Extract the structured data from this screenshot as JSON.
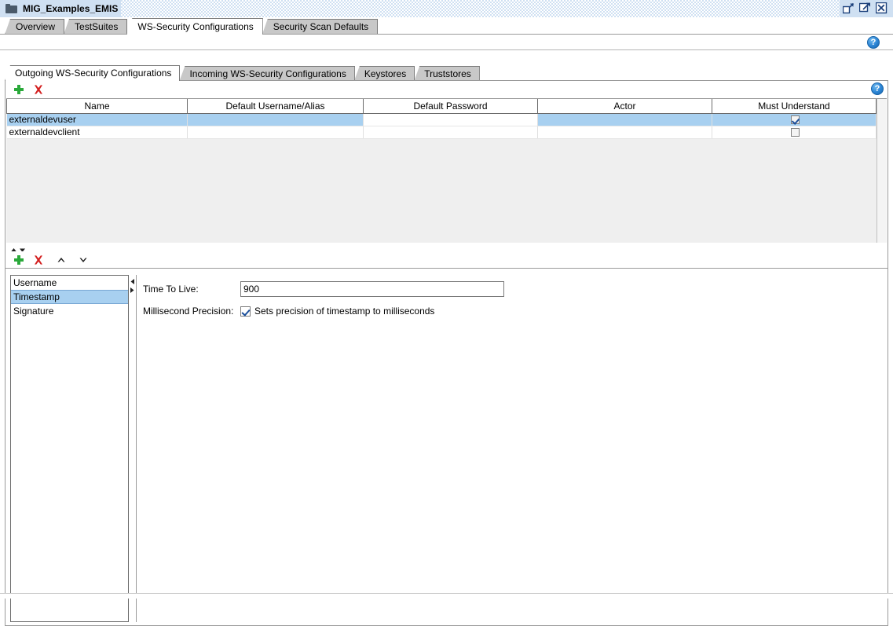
{
  "window": {
    "title": "MIG_Examples_EMIS",
    "folder_icon": "folder-icon",
    "buttons": [
      {
        "name": "restore-down-button",
        "icon": "restore-down-icon",
        "label": "Restore Down"
      },
      {
        "name": "maximize-button",
        "icon": "maximize-icon",
        "label": "Maximize"
      },
      {
        "name": "close-button",
        "icon": "close-icon",
        "label": "Close"
      }
    ]
  },
  "outer_tabs": [
    {
      "label": "Overview",
      "selected": false
    },
    {
      "label": "TestSuites",
      "selected": false
    },
    {
      "label": "WS-Security Configurations",
      "selected": true
    },
    {
      "label": "Security Scan Defaults",
      "selected": false
    }
  ],
  "inner_tabs": [
    {
      "label": "Outgoing WS-Security Configurations",
      "selected": true
    },
    {
      "label": "Incoming WS-Security Configurations",
      "selected": false
    },
    {
      "label": "Keystores",
      "selected": false
    },
    {
      "label": "Truststores",
      "selected": false
    }
  ],
  "help_icons": {
    "glyph": "?",
    "top_name": "help-icon-top",
    "inner_name": "help-icon-configurations"
  },
  "table_toolbar": {
    "add_label": "+",
    "delete_label": "✕"
  },
  "configurations_table": {
    "columns": [
      "Name",
      "Default Username/Alias",
      "Default Password",
      "Actor",
      "Must Understand"
    ],
    "rows": [
      {
        "name": "externaldevuser",
        "default_username": "",
        "default_password": "",
        "actor": "",
        "must_understand": true,
        "selected": true
      },
      {
        "name": "externaldevclient",
        "default_username": "",
        "default_password": "",
        "actor": "",
        "must_understand": false,
        "selected": false
      }
    ]
  },
  "entries_toolbar": {
    "add_label": "+",
    "delete_label": "✕",
    "move_up_label": "▲",
    "move_down_label": "▼"
  },
  "entries_list": [
    {
      "label": "Username",
      "selected": false
    },
    {
      "label": "Timestamp",
      "selected": true
    },
    {
      "label": "Signature",
      "selected": false
    }
  ],
  "entry_form": {
    "ttl_label": "Time To Live:",
    "ttl_value": "900",
    "ttl_placeholder": "",
    "precision_label": "Millisecond Precision:",
    "precision_checked": true,
    "precision_text": "Sets precision of timestamp to milliseconds"
  },
  "colors": {
    "title_bar": "#cfe0f2",
    "selection": "#a8d0f0",
    "tab_inactive": "#c8c8c8",
    "panel_empty": "#efefef",
    "add_green": "#2aa93a",
    "delete_red": "#d32020",
    "help_blue": "#2b84d4"
  }
}
